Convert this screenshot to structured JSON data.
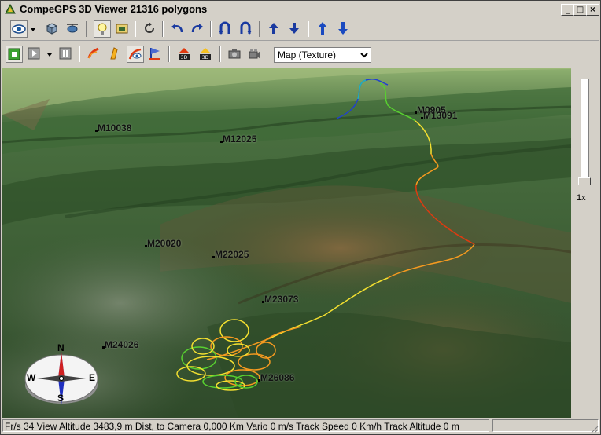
{
  "window": {
    "title": "CompeGPS 3D Viewer  21316 polygons",
    "minimize_glyph": "_",
    "maximize_glyph": "□",
    "close_glyph": "×"
  },
  "toolbar1": {
    "icons": [
      "eye-view-icon",
      "cube-view-icon",
      "helicopter-view-icon",
      "lightbulb-icon",
      "texture-icon",
      "rotate-icon",
      "undo-arrow-icon",
      "redo-arrow-icon",
      "tilt-left-icon",
      "tilt-right-icon",
      "up-arrow-icon",
      "down-arrow-icon",
      "up-arrow-blue-icon",
      "down-arrow-blue-icon"
    ]
  },
  "toolbar2": {
    "map_select": {
      "selected": "Map (Texture)"
    },
    "icons": [
      "stop-icon",
      "play-icon",
      "pause-icon",
      "track-color-icon",
      "track-3d-icon",
      "track-eye-icon",
      "track-flag-icon",
      "export-3d-icon",
      "export-3d-alt-icon",
      "camera-icon",
      "video-camera-icon"
    ]
  },
  "waypoints": [
    {
      "label": "M10038"
    },
    {
      "label": "M12025"
    },
    {
      "label": "M0905"
    },
    {
      "label": "M13091"
    },
    {
      "label": "M20020"
    },
    {
      "label": "M22025"
    },
    {
      "label": "M23073"
    },
    {
      "label": "M24026"
    },
    {
      "label": "M26086"
    }
  ],
  "compass": {
    "n": "N",
    "s": "S",
    "e": "E",
    "w": "W"
  },
  "speed_label": "1x",
  "status": {
    "text": "Fr/s 34 View Altitude 3483,9 m Dist, to Camera 0,000 Km Vario 0 m/s Track Speed 0 Km/h Track Altitude 0 m"
  },
  "colors": {
    "terrain_dark": "#2f4a2a",
    "terrain_light": "#6f8f55",
    "track_red": "#e03a10",
    "track_orange": "#f59a20",
    "track_yellow": "#f4e030",
    "track_green": "#58d030",
    "track_blue": "#2040d0"
  }
}
